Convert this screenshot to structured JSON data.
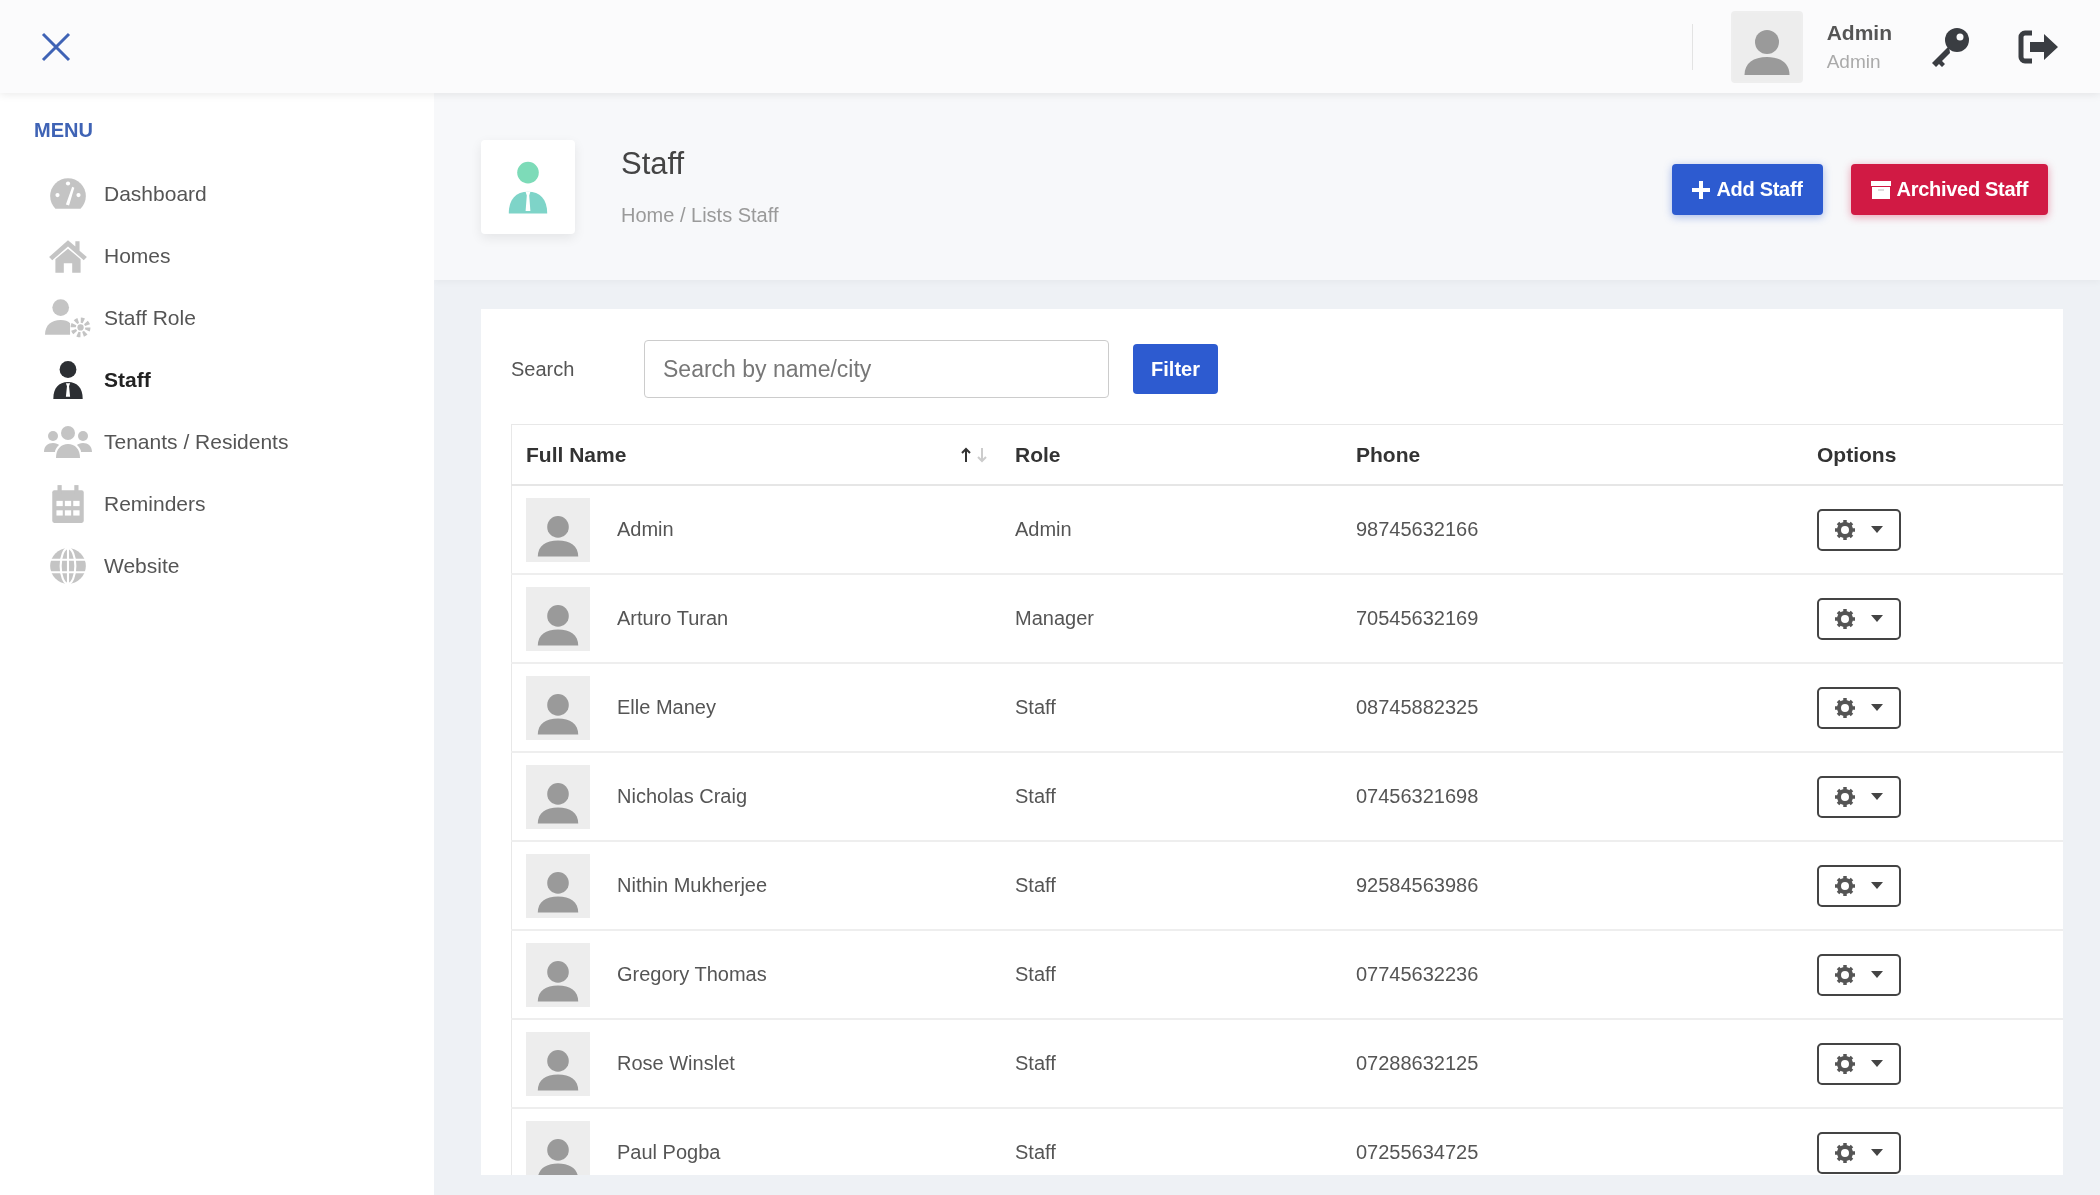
{
  "topbar": {
    "user": {
      "name": "Admin",
      "role": "Admin"
    }
  },
  "sidebar": {
    "title": "MENU",
    "items": [
      {
        "label": "Dashboard",
        "kind": "dashboard",
        "selected": false
      },
      {
        "label": "Homes",
        "kind": "home",
        "selected": false
      },
      {
        "label": "Staff Role",
        "kind": "role",
        "selected": false
      },
      {
        "label": "Staff",
        "kind": "staff",
        "selected": true
      },
      {
        "label": "Tenants / Residents",
        "kind": "tenants",
        "selected": false
      },
      {
        "label": "Reminders",
        "kind": "calendar",
        "selected": false
      },
      {
        "label": "Website",
        "kind": "globe",
        "selected": false
      }
    ]
  },
  "page": {
    "title": "Staff",
    "breadcrumb": "Home / Lists Staff",
    "actions": [
      {
        "label": "Add Staff",
        "kind": "add"
      },
      {
        "label": "Archived Staff",
        "kind": "archive"
      }
    ]
  },
  "search": {
    "label": "Search",
    "placeholder": "Search by name/city",
    "button": "Filter"
  },
  "table": {
    "columns": [
      "Full Name",
      "Role",
      "Phone",
      "Options"
    ],
    "rows": [
      {
        "name": "Admin",
        "role": "Admin",
        "phone": "98745632166"
      },
      {
        "name": "Arturo Turan",
        "role": "Manager",
        "phone": "70545632169"
      },
      {
        "name": "Elle Maney",
        "role": "Staff",
        "phone": "08745882325"
      },
      {
        "name": "Nicholas Craig",
        "role": "Staff",
        "phone": "07456321698"
      },
      {
        "name": "Nithin Mukherjee",
        "role": "Staff",
        "phone": "92584563986"
      },
      {
        "name": "Gregory Thomas",
        "role": "Staff",
        "phone": "07745632236"
      },
      {
        "name": "Rose Winslet",
        "role": "Staff",
        "phone": "07288632125"
      },
      {
        "name": "Paul Pogba",
        "role": "Staff",
        "phone": "07255634725"
      }
    ]
  }
}
